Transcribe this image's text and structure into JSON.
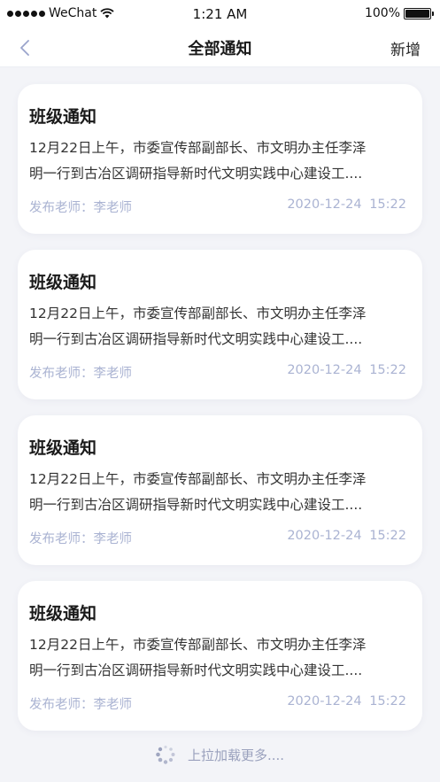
{
  "status_bar": {
    "carrier": "WeChat",
    "time": "1:21 AM",
    "battery": "100%"
  },
  "nav": {
    "back_icon": "chevron-left-icon",
    "title": "全部通知",
    "action_label": "新增"
  },
  "notices": [
    {
      "title": "班级通知",
      "body_line1": "12月22日上午，市委宣传部副部长、市文明办主任李泽",
      "body_line2": "明一行到古冶区调研指导新时代文明实践中心建设工....",
      "teacher": "发布老师：李老师",
      "datetime": "2020-12-24 15:22"
    },
    {
      "title": "班级通知",
      "body_line1": "12月22日上午，市委宣传部副部长、市文明办主任李泽",
      "body_line2": "明一行到古冶区调研指导新时代文明实践中心建设工....",
      "teacher": "发布老师：李老师",
      "datetime": "2020-12-24 15:22"
    },
    {
      "title": "班级通知",
      "body_line1": "12月22日上午，市委宣传部副部长、市文明办主任李泽",
      "body_line2": "明一行到古冶区调研指导新时代文明实践中心建设工....",
      "teacher": "发布老师：李老师",
      "datetime": "2020-12-24 15:22"
    },
    {
      "title": "班级通知",
      "body_line1": "12月22日上午，市委宣传部副部长、市文明办主任李泽",
      "body_line2": "明一行到古冶区调研指导新时代文明实践中心建设工....",
      "teacher": "发布老师：李老师",
      "datetime": "2020-12-24 15:22"
    }
  ],
  "load_more": {
    "label": "上拉加载更多....",
    "icon": "loading-spinner-icon"
  },
  "colors": {
    "background": "#f3f4f8",
    "card": "#ffffff",
    "meta_text": "#aab3d2",
    "back_icon": "#9aa4cc"
  }
}
